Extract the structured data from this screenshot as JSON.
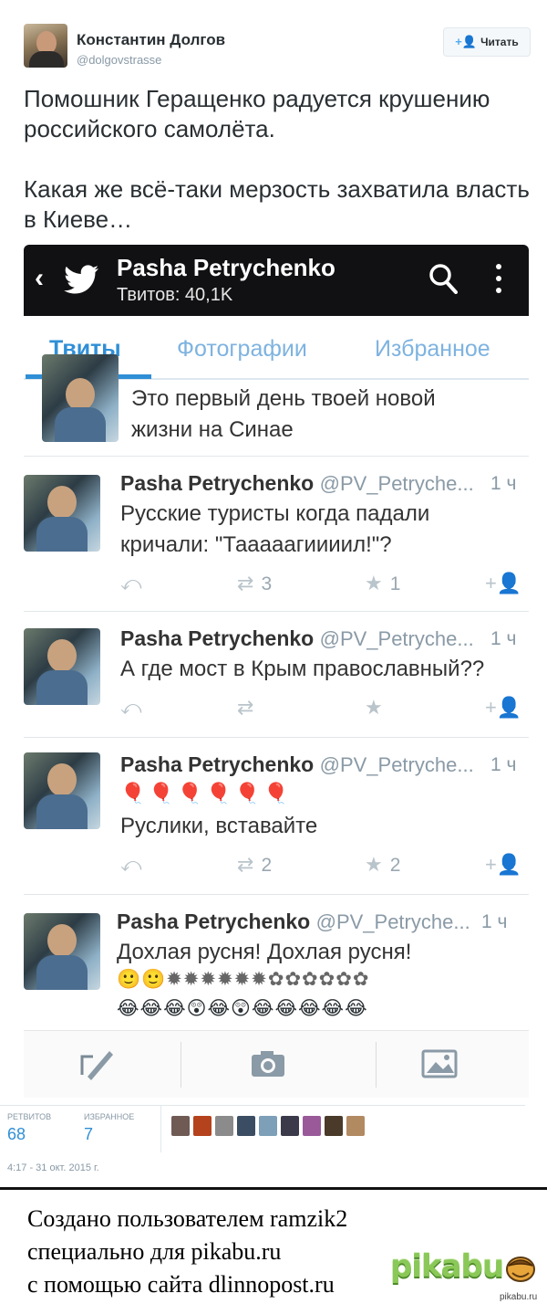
{
  "tweet": {
    "author_name": "Константин Долгов",
    "author_handle": "@dolgovstrasse",
    "follow_label": "Читать",
    "text_paragraphs": [
      "Помошник Геращенко радуется крушению российского самолёта.",
      "Какая же всё-таки мерзость захватила власть в Киеве…"
    ],
    "stats": {
      "retweets_label": "РЕТВИТОВ",
      "retweets_value": "68",
      "favorites_label": "ИЗБРАННОЕ",
      "favorites_value": "7"
    },
    "date": "4:17 - 31 окт. 2015 г."
  },
  "screenshot": {
    "profile_title": "Pasha Petrychenko",
    "profile_subtitle": "Твитов: 40,1K",
    "tabs": [
      "Твиты",
      "Фотографии",
      "Избранное"
    ],
    "partial_tweet_lines": [
      "Это первый день твоей новой",
      "жизни на Синае"
    ],
    "tweets": [
      {
        "name": "Pasha Petrychenko",
        "handle": "@PV_Petryche...",
        "time": "1 ч",
        "lines": [
          "Русские туристы когда падали",
          "кричали: \"Тааааагиииил!\"?"
        ],
        "retweets": "3",
        "favorites": "1"
      },
      {
        "name": "Pasha Petrychenko",
        "handle": "@PV_Petryche...",
        "time": "1 ч",
        "lines": [
          "А где мост в Крым православный??"
        ],
        "retweets": "",
        "favorites": ""
      },
      {
        "name": "Pasha Petrychenko",
        "handle": "@PV_Petryche...",
        "time": "1 ч",
        "emoji_line": "🎈🎈🎈🎈🎈🎈",
        "lines": [
          "Руслики, вставайте"
        ],
        "retweets": "2",
        "favorites": "2"
      },
      {
        "name": "Pasha Petrychenko",
        "handle": "@PV_Petryche...",
        "time": "1 ч",
        "lines": [
          "Дохлая русня! Дохлая русня!"
        ],
        "emoji_line_1": "🙂🙂✹✹✹✹✹✹✿✿✿✿✿✿",
        "emoji_line_2": "😂😂😂😲😂😲😂😂😂😂😂"
      }
    ]
  },
  "footer": {
    "lines": [
      "Создано пользователем ramzik2",
      "специально для pikabu.ru",
      "с помощью сайта dlinnopost.ru"
    ],
    "logo_text": "pikabu",
    "small_domain": "pikabu.ru"
  },
  "colors": {
    "accent": "#2f8fd6",
    "pikabu_green": "#8ac858"
  }
}
